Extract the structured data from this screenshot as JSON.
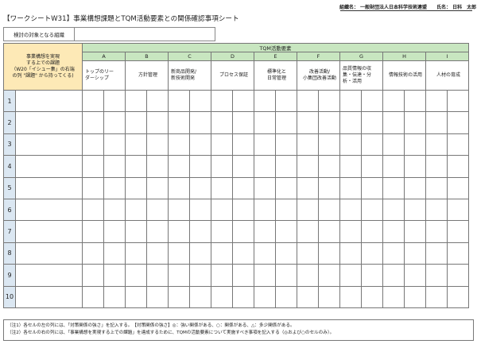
{
  "title": "【ワークシートW31】事業構想課題とTQM活動要素との関係確認事項シート",
  "org": {
    "org_label": "組織名：",
    "org_value": "一般財団法人日本科学技術連盟",
    "name_label": "氏名：",
    "name_value": "日科　太郎"
  },
  "target": {
    "label": "検討の対象となる組織",
    "value": ""
  },
  "table": {
    "group_header": "TQM活動要素",
    "corner": [
      "事業構想を実現",
      "する上での課題",
      "（W20「イシュー集」の右端",
      "の列 \"課題\" から持ってくる)"
    ],
    "columns": [
      {
        "letter": "A",
        "label": [
          "トップのリー",
          "ダーシップ"
        ]
      },
      {
        "letter": "B",
        "label": [
          "方針管理"
        ]
      },
      {
        "letter": "C",
        "label": [
          "新商品開発/",
          "新技術開発"
        ]
      },
      {
        "letter": "D",
        "label": [
          "プロセス保証"
        ]
      },
      {
        "letter": "E",
        "label": [
          "標準化と",
          "日常管理"
        ]
      },
      {
        "letter": "F",
        "label": [
          "改善活動/",
          "小集団改善活動"
        ]
      },
      {
        "letter": "G",
        "label": [
          "品質情報の収",
          "集・伝達・分",
          "析・活用"
        ]
      },
      {
        "letter": "H",
        "label": [
          "情報技術の活用"
        ]
      },
      {
        "letter": "I",
        "label": [
          "人材の育成"
        ]
      }
    ],
    "rows": [
      "1",
      "2",
      "3",
      "4",
      "5",
      "6",
      "7",
      "8",
      "9",
      "10"
    ]
  },
  "notes": [
    "（注1）各セルの左の列には、「対策関係の強さ」を記入する。　【対策関係の強さ】◎：強い関係がある、○：関係がある、△：多少関係がある。",
    "（注2）各セルの右の列には、「事業構想を実現する上での課題」を達成するために、TQMの活動要素について実施すべき事項を記入する（◎および○のセルのみ）。"
  ]
}
